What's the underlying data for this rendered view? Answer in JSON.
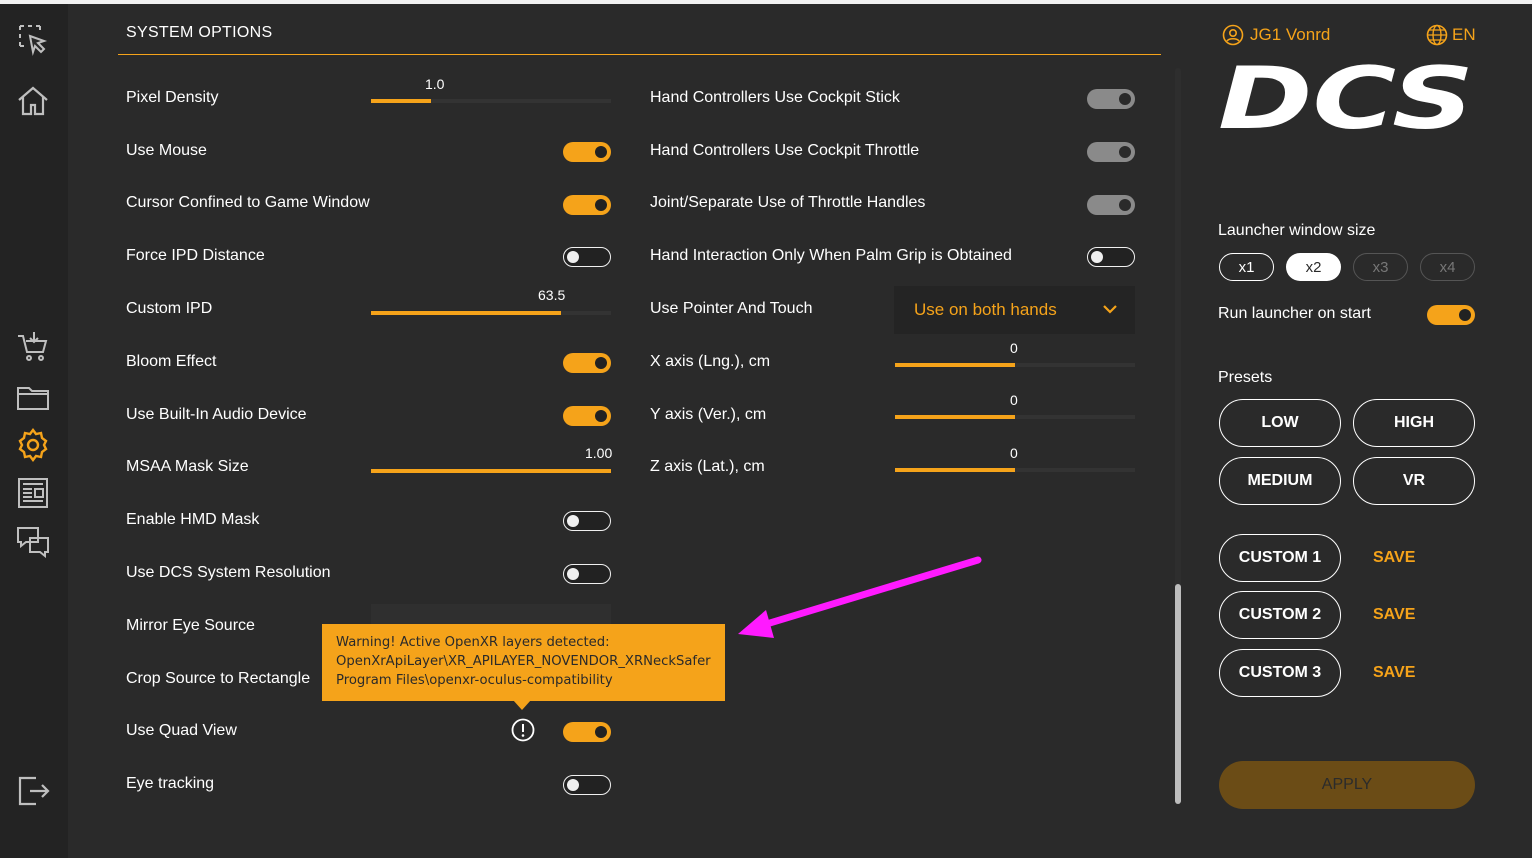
{
  "section": {
    "title": "SYSTEM OPTIONS"
  },
  "left_settings": {
    "pixel_density": {
      "label": "Pixel Density",
      "value": "1.0",
      "fraction": 0.25
    },
    "use_mouse": {
      "label": "Use Mouse",
      "state": "on"
    },
    "cursor_confined": {
      "label": "Cursor Confined to Game Window",
      "state": "on"
    },
    "force_ipd": {
      "label": "Force IPD Distance",
      "state": "off"
    },
    "custom_ipd": {
      "label": "Custom IPD",
      "value": "63.5",
      "fraction": 0.79
    },
    "bloom_effect": {
      "label": "Bloom Effect",
      "state": "on"
    },
    "builtin_audio": {
      "label": "Use Built-In Audio Device",
      "state": "on"
    },
    "msaa_mask_size": {
      "label": "MSAA Mask Size",
      "value": "1.00",
      "fraction": 1.0
    },
    "hmd_mask": {
      "label": "Enable HMD Mask",
      "state": "off"
    },
    "dcs_resolution": {
      "label": "Use DCS System Resolution",
      "state": "off"
    },
    "mirror_eye_source": {
      "label": "Mirror Eye Source",
      "value": ""
    },
    "crop_source": {
      "label": "Crop Source to Rectangle"
    },
    "quad_view": {
      "label": "Use Quad View",
      "state": "on"
    },
    "eye_tracking": {
      "label": "Eye tracking",
      "state": "off"
    }
  },
  "right_settings": {
    "hc_stick": {
      "label": "Hand Controllers Use Cockpit Stick",
      "state": "disabled"
    },
    "hc_throttle": {
      "label": "Hand Controllers Use Cockpit Throttle",
      "state": "disabled"
    },
    "throttle_handles": {
      "label": "Joint/Separate Use of Throttle Handles",
      "state": "disabled"
    },
    "palm_grip": {
      "label": "Hand Interaction Only When Palm Grip is Obtained",
      "state": "off"
    },
    "pointer_touch": {
      "label": "Use Pointer And Touch",
      "value": "Use on both hands"
    },
    "x_axis": {
      "label": "X axis (Lng.), cm",
      "value": "0",
      "fraction": 0.5
    },
    "y_axis": {
      "label": "Y axis (Ver.), cm",
      "value": "0",
      "fraction": 0.5
    },
    "z_axis": {
      "label": "Z axis (Lat.), cm",
      "value": "0",
      "fraction": 0.5
    }
  },
  "tooltip": {
    "line1": "Warning! Active OpenXR layers detected:",
    "line2": "OpenXrApiLayer\\XR_APILAYER_NOVENDOR_XRNeckSafer",
    "line3": "Program Files\\openxr-oculus-compatibility"
  },
  "header": {
    "user": "JG1 Vonrd",
    "language": "EN",
    "logo": "DCS"
  },
  "launcher": {
    "size_label": "Launcher window size",
    "sizes": [
      "x1",
      "x2",
      "x3",
      "x4"
    ],
    "selected_size": "x2",
    "run_on_start_label": "Run launcher on start",
    "run_on_start": "on"
  },
  "presets": {
    "label": "Presets",
    "low": "LOW",
    "high": "HIGH",
    "medium": "MEDIUM",
    "vr": "VR",
    "custom1": "CUSTOM 1",
    "custom2": "CUSTOM 2",
    "custom3": "CUSTOM 3",
    "save": "SAVE"
  },
  "apply_label": "APPLY",
  "colors": {
    "accent": "#f5a31a",
    "background": "#2a2a2a",
    "sidebar": "#232323",
    "annotation_arrow": "#ff1aff"
  },
  "sidebar_icons": [
    "select-tool-icon",
    "home-icon",
    "shop-cart-icon",
    "folder-icon",
    "settings-gear-icon",
    "news-icon",
    "social-chat-icon",
    "exit-icon"
  ]
}
